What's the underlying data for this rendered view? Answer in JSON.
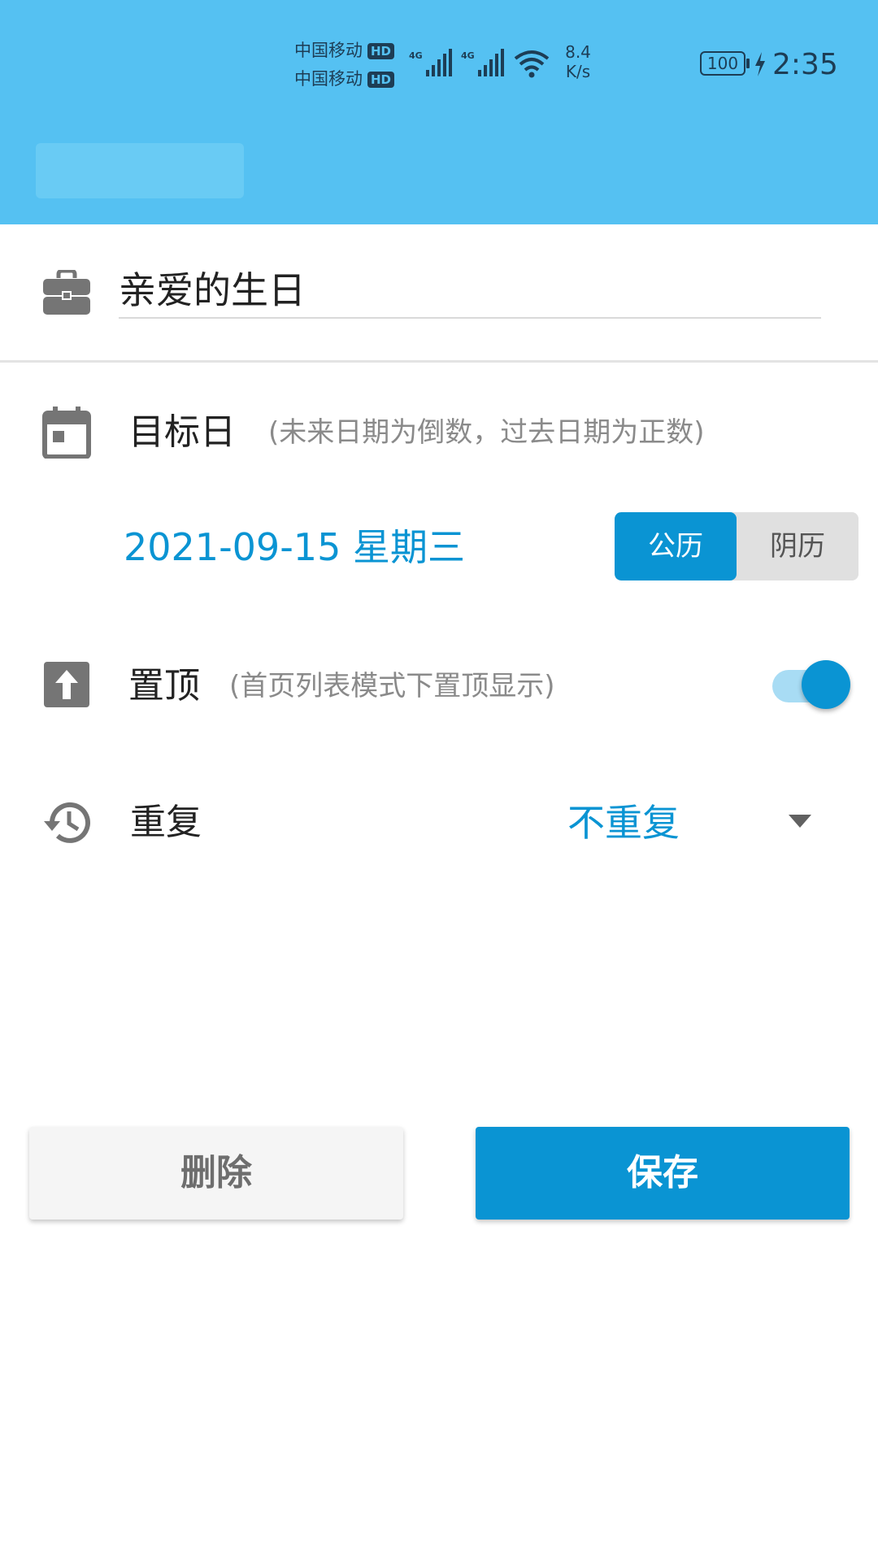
{
  "status_bar": {
    "carrier1": "中国移动",
    "carrier2": "中国移动",
    "hd_badge": "HD",
    "network1": "4G",
    "network2": "4G",
    "speed_value": "8.4",
    "speed_unit": "K/s",
    "battery": "100",
    "time": "2:35"
  },
  "event": {
    "title": "亲爱的生日"
  },
  "target_date": {
    "label": "目标日",
    "hint": "(未来日期为倒数，过去日期为正数)",
    "value": "2021-09-15 星期三",
    "calendar_options": [
      "公历",
      "阴历"
    ],
    "selected_calendar": "公历"
  },
  "pin": {
    "label": "置顶",
    "hint": "(首页列表模式下置顶显示)",
    "enabled": true
  },
  "repeat": {
    "label": "重复",
    "value": "不重复"
  },
  "actions": {
    "delete_label": "删除",
    "save_label": "保存"
  },
  "colors": {
    "header_bg": "#55c1f2",
    "accent": "#0a94d3",
    "icon_gray": "#757575"
  }
}
